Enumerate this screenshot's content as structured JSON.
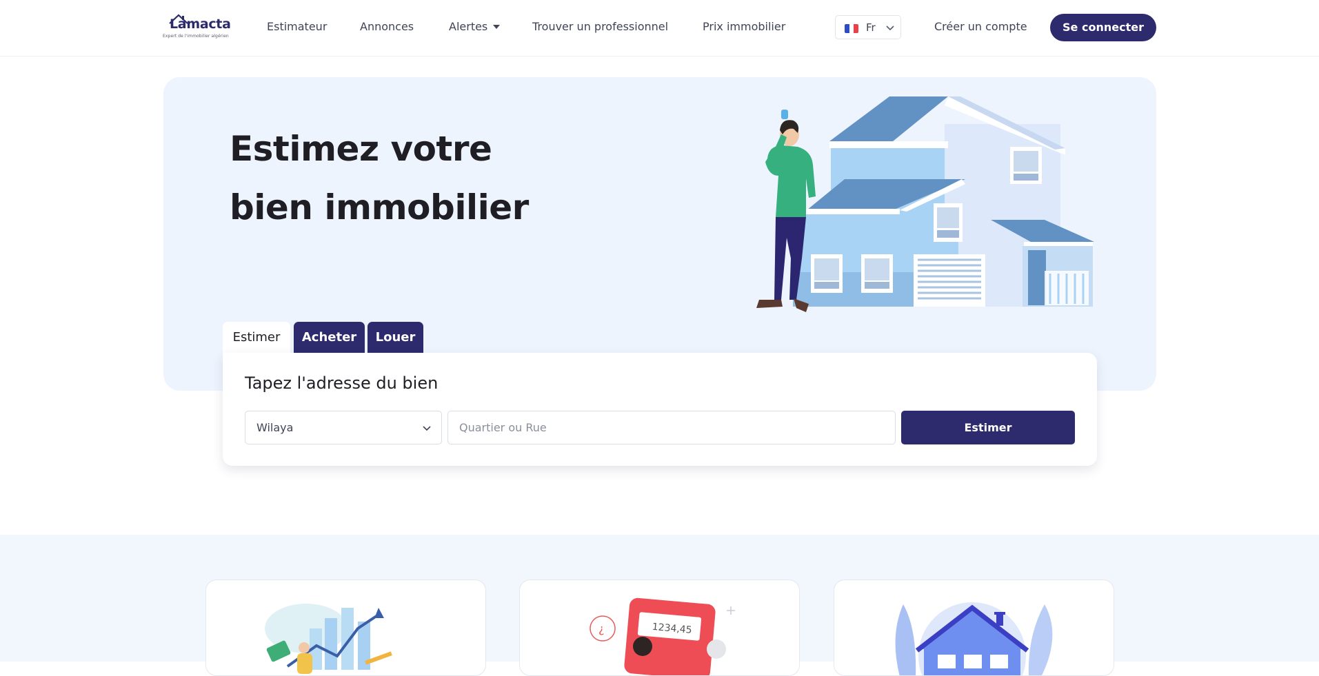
{
  "header": {
    "logo": {
      "name": "Lamacta",
      "tagline": "Expert de l'immobilier algérien"
    },
    "nav": [
      {
        "label": "Estimateur"
      },
      {
        "label": "Annonces"
      },
      {
        "label": "Alertes"
      },
      {
        "label": "Trouver un professionnel"
      },
      {
        "label": "Prix immobilier"
      }
    ],
    "language": {
      "label": "Fr",
      "flag_colors": [
        "#2f4cc4",
        "#ffffff",
        "#e8414a"
      ]
    },
    "create_account": "Créer un compte",
    "login": "Se connecter"
  },
  "hero": {
    "title_line1": "Estimez votre",
    "title_line2": "bien immobilier"
  },
  "search": {
    "tabs": [
      {
        "label": "Estimer",
        "active": true
      },
      {
        "label": "Acheter",
        "active": false
      },
      {
        "label": "Louer",
        "active": false
      }
    ],
    "title": "Tapez l'adresse du bien",
    "wilaya": {
      "value": "Wilaya"
    },
    "address": {
      "placeholder": "Quartier ou Rue"
    },
    "submit": "Estimer"
  },
  "features": {
    "cards": [
      {
        "icon": "market-growth-illustration"
      },
      {
        "icon": "calculator-illustration",
        "display": "1234,45"
      },
      {
        "icon": "house-illustration"
      }
    ]
  },
  "colors": {
    "primary": "#2e2a6e",
    "hero_background": "#eef4fe",
    "section_background": "#f2f6fd"
  }
}
